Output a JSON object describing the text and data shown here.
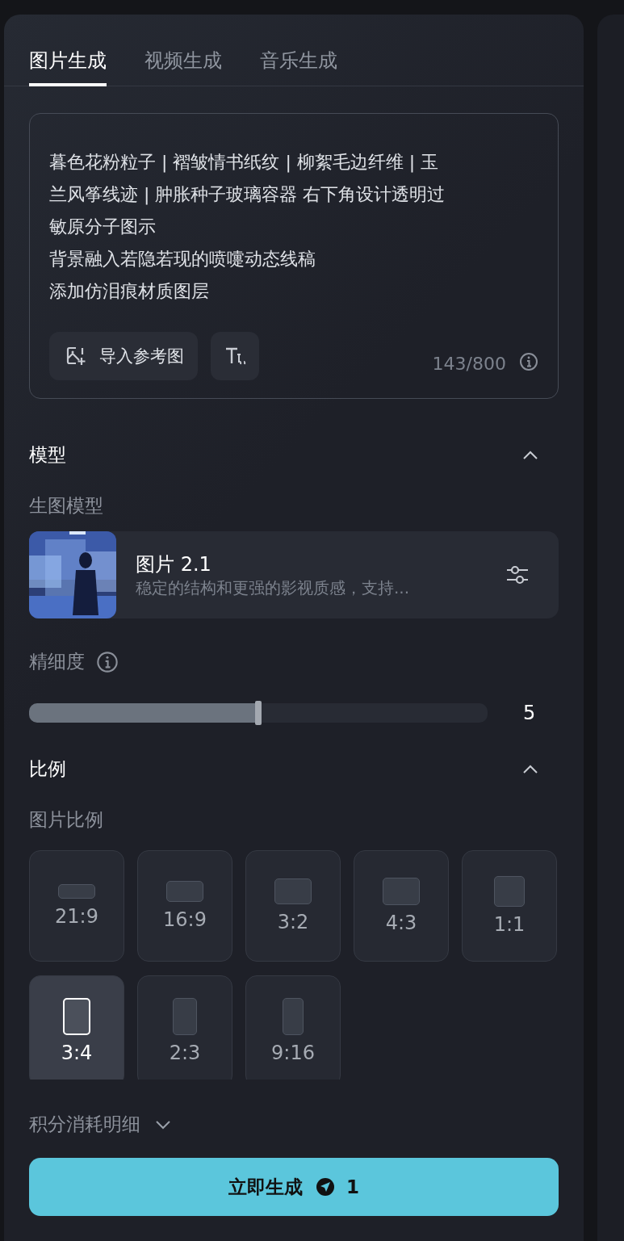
{
  "tabs": [
    {
      "label": "图片生成",
      "selected": true
    },
    {
      "label": "视频生成",
      "selected": false
    },
    {
      "label": "音乐生成",
      "selected": false
    }
  ],
  "prompt": {
    "lines": [
      "暮色花粉粒子 | 褶皱情书纸纹 | 柳絮毛边纤维 | 玉",
      "兰风筝线迹 | 肿胀种子玻璃容器  右下角设计透明过",
      "敏原分子图示",
      "背景融入若隐若现的喷嚏动态线稿",
      "添加仿泪痕材质图层"
    ],
    "import_button": "导入参考图",
    "counter": "143/800"
  },
  "model_section": {
    "title": "模型",
    "expanded": true,
    "label": "生图模型",
    "model": {
      "name": "图片 2.1",
      "description": "稳定的结构和更强的影视质感，支持..."
    }
  },
  "detail": {
    "label": "精细度",
    "level": 0.5,
    "reading": "5"
  },
  "ratio_section": {
    "title": "比例",
    "expanded": true,
    "label": "图片比例",
    "ratios": [
      {
        "label": "21:9",
        "kind": "ultrawide",
        "selected": false
      },
      {
        "label": "16:9",
        "kind": "wide",
        "selected": false
      },
      {
        "label": "3:2",
        "selected": false
      },
      {
        "label": "4:3",
        "kind": "classic",
        "selected": false
      },
      {
        "label": "1:1",
        "kind": "square",
        "selected": false
      },
      {
        "label": "3:4",
        "kind": "portrait",
        "selected": true
      },
      {
        "label": "2:3",
        "kind": "tall",
        "selected": false
      },
      {
        "label": "9:16",
        "kind": "phone",
        "selected": false
      }
    ]
  },
  "credits": {
    "label": "积分消耗明细",
    "expanded": false
  },
  "generate_button": {
    "label": "立即生成",
    "cost": "1"
  }
}
